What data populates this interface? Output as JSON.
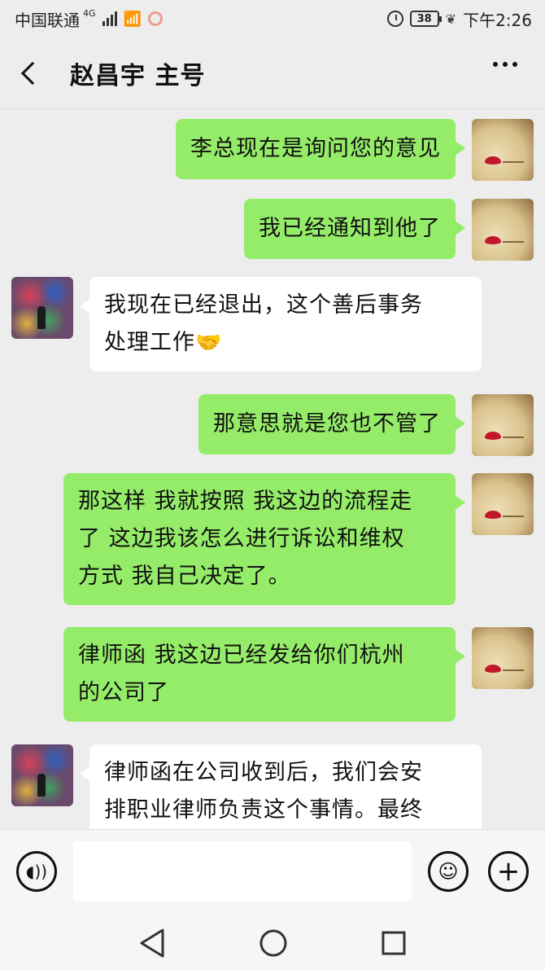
{
  "status_bar": {
    "carrier": "中国联通",
    "network": "4G",
    "battery": "38",
    "time": "下午2:26"
  },
  "header": {
    "title": "赵昌宇 主号"
  },
  "messages": [
    {
      "sender": "self",
      "text": "李总现在是询问您的意见"
    },
    {
      "sender": "self",
      "text": "我已经通知到他了"
    },
    {
      "sender": "other",
      "line1": "我现在已经退出，这个善后事务",
      "line2": "处理工作",
      "emoji": "🤝"
    },
    {
      "sender": "self",
      "text": "那意思就是您也不管了"
    },
    {
      "sender": "self",
      "line1": "那这样 我就按照 我这边的流程走",
      "line2": "了 这边我该怎么进行诉讼和维权",
      "line3": "方式 我自己决定了。"
    },
    {
      "sender": "self",
      "line1": "律师函 我这边已经发给你们杭州",
      "line2": "的公司了"
    },
    {
      "sender": "other",
      "line1": "律师函在公司收到后，我们会安",
      "line2": "排职业律师负责这个事情。最终"
    }
  ],
  "input": {
    "placeholder": ""
  },
  "icons": {
    "voice": "voice-icon",
    "emoji": "emoji-icon",
    "plus": "plus-icon"
  },
  "colors": {
    "self_bubble": "#95ec69",
    "other_bubble": "#ffffff",
    "background": "#ededed"
  }
}
